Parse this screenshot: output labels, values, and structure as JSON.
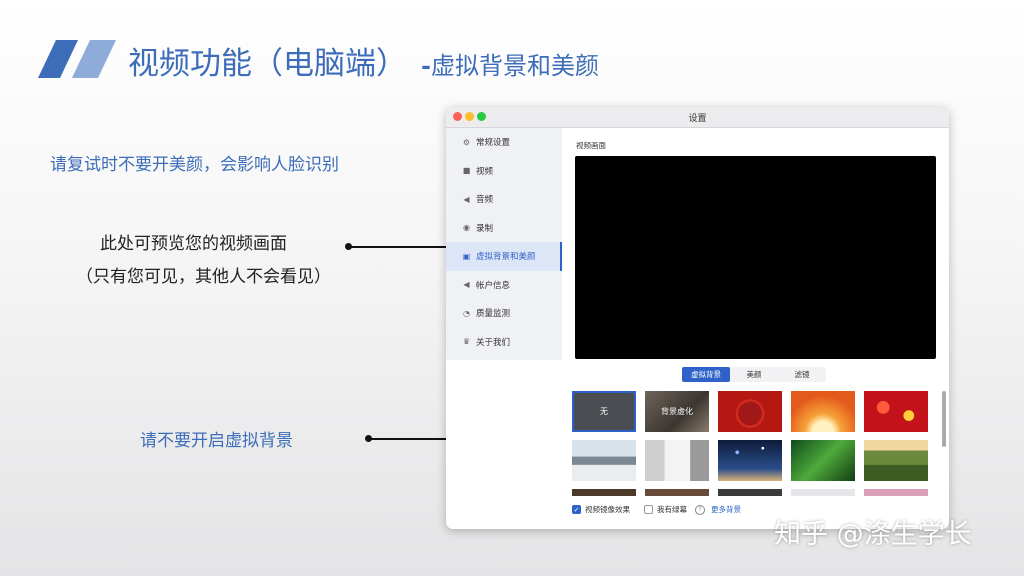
{
  "slide": {
    "title_main": "视频功能（电脑端）",
    "title_dash": "-",
    "title_sub": "虚拟背景和美颜",
    "note_top": "请复试时不要开美颜，会影响人脸识别",
    "preview_note_line1": "此处可预览您的视频画面",
    "preview_note_line2": "（只有您可见，其他人不会看见）",
    "note_bottom": "请不要开启虚拟背景",
    "watermark": "知乎 @涤生学长",
    "accent_color": "#3d6db8"
  },
  "window": {
    "title": "设置",
    "sidebar": [
      {
        "label": "常规设置",
        "icon": "gear-icon"
      },
      {
        "label": "视频",
        "icon": "video-camera-icon"
      },
      {
        "label": "音频",
        "icon": "speaker-icon"
      },
      {
        "label": "录制",
        "icon": "record-icon"
      },
      {
        "label": "虚拟背景和美颜",
        "icon": "user-portrait-icon",
        "active": true
      },
      {
        "label": "帐户信息",
        "icon": "account-icon"
      },
      {
        "label": "质量监测",
        "icon": "gauge-icon"
      },
      {
        "label": "关于我们",
        "icon": "crown-icon"
      }
    ],
    "preview_label": "视频画面",
    "tabs": [
      "虚拟背景",
      "美颜",
      "滤镜"
    ],
    "active_tab": "虚拟背景",
    "backgrounds": [
      "无",
      "背景虚化"
    ],
    "mirror_label": "视频镜像效果",
    "mirror_checked": true,
    "greenscreen_label": "我有绿幕",
    "greenscreen_checked": false,
    "more_label": "更多背景"
  }
}
